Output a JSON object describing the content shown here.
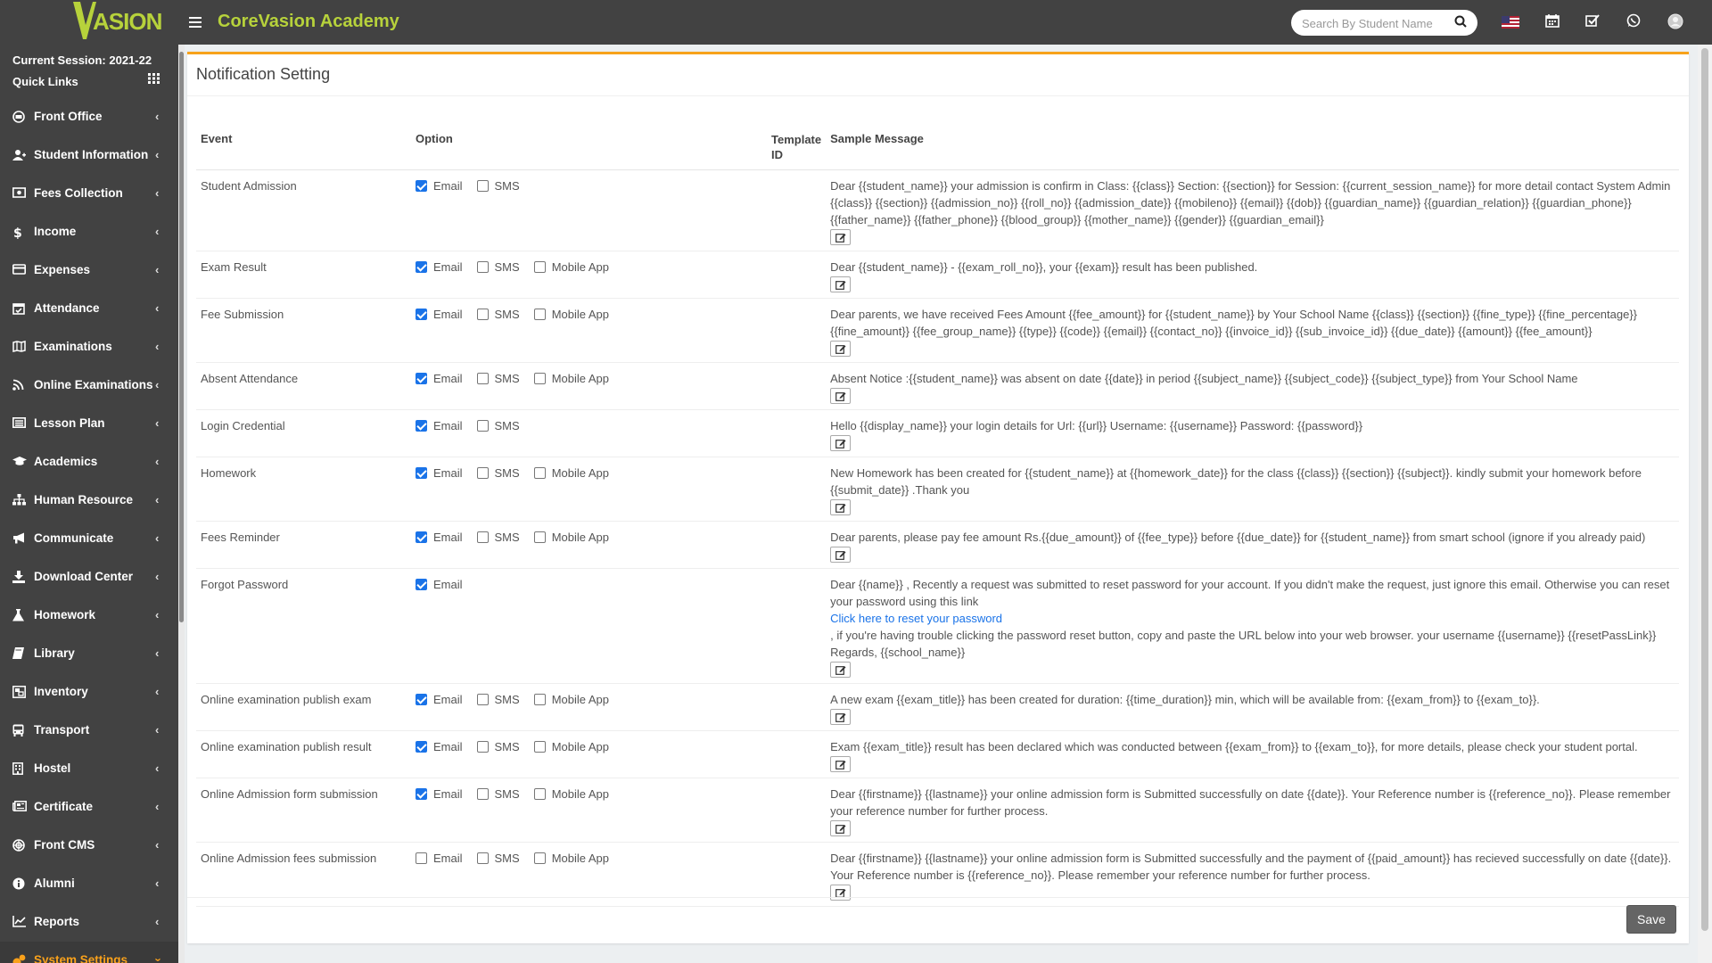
{
  "header": {
    "logo_text": "ASION",
    "app_title": "CoreVasion Academy",
    "search_placeholder": "Search By Student Name"
  },
  "sidebar": {
    "session": "Current Session: 2021-22",
    "quick_links": "Quick Links",
    "items": [
      {
        "label": "Front Office",
        "icon": "front-office-icon"
      },
      {
        "label": "Student Information",
        "icon": "user-icon"
      },
      {
        "label": "Fees Collection",
        "icon": "money-icon"
      },
      {
        "label": "Income",
        "icon": "dollar-icon"
      },
      {
        "label": "Expenses",
        "icon": "credit-card-icon"
      },
      {
        "label": "Attendance",
        "icon": "calendar-check-icon"
      },
      {
        "label": "Examinations",
        "icon": "map-icon"
      },
      {
        "label": "Online Examinations",
        "icon": "rss-icon"
      },
      {
        "label": "Lesson Plan",
        "icon": "list-icon"
      },
      {
        "label": "Academics",
        "icon": "graduation-cap-icon"
      },
      {
        "label": "Human Resource",
        "icon": "sitemap-icon"
      },
      {
        "label": "Communicate",
        "icon": "bullhorn-icon"
      },
      {
        "label": "Download Center",
        "icon": "download-icon"
      },
      {
        "label": "Homework",
        "icon": "flask-icon"
      },
      {
        "label": "Library",
        "icon": "book-icon"
      },
      {
        "label": "Inventory",
        "icon": "object-group-icon"
      },
      {
        "label": "Transport",
        "icon": "bus-icon"
      },
      {
        "label": "Hostel",
        "icon": "building-icon"
      },
      {
        "label": "Certificate",
        "icon": "newspaper-icon"
      },
      {
        "label": "Front CMS",
        "icon": "empire-icon"
      },
      {
        "label": "Alumni",
        "icon": "info-icon"
      },
      {
        "label": "Reports",
        "icon": "line-chart-icon"
      },
      {
        "label": "System Settings",
        "icon": "gears-icon"
      }
    ]
  },
  "page": {
    "title": "Notification Setting",
    "columns": {
      "event": "Event",
      "option": "Option",
      "template": "Template ID",
      "sample": "Sample Message"
    },
    "option_labels": {
      "email": "Email",
      "sms": "SMS",
      "app": "Mobile App"
    },
    "save_label": "Save",
    "rows": [
      {
        "event": "Student Admission",
        "email": true,
        "sms": false,
        "app": null,
        "message": "Dear {{student_name}} your admission is confirm in Class: {{class}} Section: {{section}} for Session: {{current_session_name}} for more detail contact System Admin {{class}} {{section}} {{admission_no}} {{roll_no}} {{admission_date}} {{mobileno}} {{email}} {{dob}} {{guardian_name}} {{guardian_relation}} {{guardian_phone}} {{father_name}} {{father_phone}} {{blood_group}} {{mother_name}} {{gender}} {{guardian_email}}"
      },
      {
        "event": "Exam Result",
        "email": true,
        "sms": false,
        "app": false,
        "message": "Dear {{student_name}} - {{exam_roll_no}}, your {{exam}} result has been published."
      },
      {
        "event": "Fee Submission",
        "email": true,
        "sms": false,
        "app": false,
        "message": "Dear parents, we have received Fees Amount {{fee_amount}} for {{student_name}} by Your School Name {{class}} {{section}} {{fine_type}} {{fine_percentage}} {{fine_amount}} {{fee_group_name}} {{type}} {{code}} {{email}} {{contact_no}} {{invoice_id}} {{sub_invoice_id}} {{due_date}} {{amount}} {{fee_amount}}"
      },
      {
        "event": "Absent Attendance",
        "email": true,
        "sms": false,
        "app": false,
        "message": "Absent Notice :{{student_name}} was absent on date {{date}} in period {{subject_name}} {{subject_code}} {{subject_type}} from Your School Name"
      },
      {
        "event": "Login Credential",
        "email": true,
        "sms": false,
        "app": null,
        "message": "Hello {{display_name}} your login details for Url: {{url}} Username: {{username}} Password: {{password}}"
      },
      {
        "event": "Homework",
        "email": true,
        "sms": false,
        "app": false,
        "message": "New Homework has been created for {{student_name}} at {{homework_date}} for the class {{class}} {{section}} {{subject}}. kindly submit your homework before {{submit_date}} .Thank you"
      },
      {
        "event": "Fees Reminder",
        "email": true,
        "sms": false,
        "app": false,
        "message": "Dear parents, please pay fee amount Rs.{{due_amount}} of {{fee_type}} before {{due_date}} for {{student_name}} from smart school (ignore if you already paid)"
      },
      {
        "event": "Forgot Password",
        "email": true,
        "sms": null,
        "app": null,
        "message": "Dear {{name}} , Recently a request was submitted to reset password for your account. If you didn't make the request, just ignore this email. Otherwise you can reset your password using this link",
        "link": "Click here to reset your password",
        "message_after": ", if you're having trouble clicking the password reset button, copy and paste the URL below into your web browser. your username {{username}} {{resetPassLink}} Regards, {{school_name}}"
      },
      {
        "event": "Online examination publish exam",
        "email": true,
        "sms": false,
        "app": false,
        "message": "A new exam {{exam_title}} has been created for duration: {{time_duration}} min, which will be available from: {{exam_from}} to {{exam_to}}."
      },
      {
        "event": "Online examination publish result",
        "email": true,
        "sms": false,
        "app": false,
        "message": "Exam {{exam_title}} result has been declared which was conducted between {{exam_from}} to {{exam_to}}, for more details, please check your student portal."
      },
      {
        "event": "Online Admission form submission",
        "email": true,
        "sms": false,
        "app": false,
        "message": "Dear {{firstname}} {{lastname}} your online admission form is Submitted successfully on date {{date}}. Your Reference number is {{reference_no}}. Please remember your reference number for further process."
      },
      {
        "event": "Online Admission fees submission",
        "email": false,
        "sms": false,
        "app": false,
        "message": "Dear {{firstname}} {{lastname}} your online admission form is Submitted successfully and the payment of {{paid_amount}} has recieved successfully on date {{date}}. Your Reference number is {{reference_no}}. Please remember your reference number for further process."
      }
    ]
  },
  "colors": {
    "topbar": "#424242",
    "accent": "#f7a21b",
    "brand": "#b7d23b",
    "checkbox": "#1a73e8"
  }
}
